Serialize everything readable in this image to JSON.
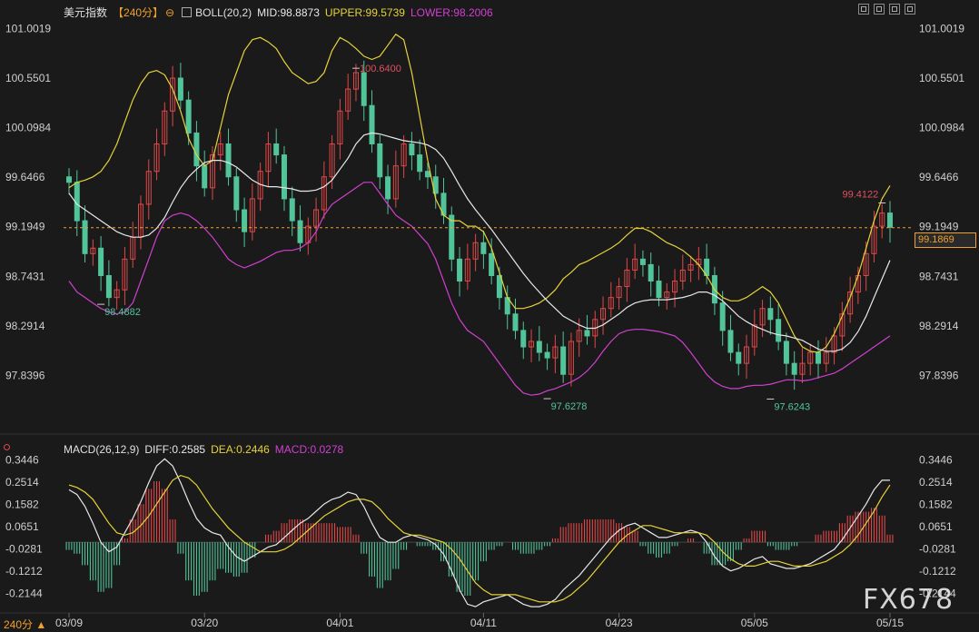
{
  "header": {
    "name": "美元指数",
    "period": "【240分】",
    "indicator": "BOLL(20,2)",
    "mid": "MID:98.8873",
    "upper": "UPPER:99.5739",
    "lower": "LOWER:98.2006"
  },
  "macd_header": {
    "label": "MACD(26,12,9)",
    "diff": "DIFF:0.2585",
    "dea": "DEA:0.2446",
    "macd": "MACD:0.0278"
  },
  "period_bottom": "240分",
  "watermark": "FX678",
  "current_price": "99.1869",
  "colors": {
    "background": "#1a1a1a",
    "up": "#e04848",
    "down": "#52c49a",
    "mid": "#e8e8e8",
    "upper": "#e6d23a",
    "lower": "#d040d0",
    "accent": "#f0a030"
  },
  "chart_data": [
    {
      "type": "candlestick",
      "name": "price",
      "y_ticks": [
        "101.0019",
        "100.5501",
        "100.0984",
        "99.6466",
        "99.1949",
        "98.7431",
        "98.2914",
        "97.8396"
      ],
      "ylim": [
        97.62,
        101.08
      ],
      "x_ticks": [
        "03/09",
        "03/20",
        "04/01",
        "04/11",
        "04/23",
        "05/05",
        "05/15"
      ],
      "annotations": [
        {
          "label": "100.6400",
          "value": 100.64
        },
        {
          "label": "98.4882",
          "value": 98.4882
        },
        {
          "label": "97.6278",
          "value": 97.6278
        },
        {
          "label": "97.6243",
          "value": 97.6243
        },
        {
          "label": "99.4122",
          "value": 99.4122
        }
      ],
      "close": [
        99.6,
        99.25,
        98.95,
        99.0,
        98.75,
        98.55,
        98.62,
        98.9,
        99.1,
        99.4,
        99.7,
        99.95,
        100.25,
        100.55,
        100.35,
        100.05,
        99.75,
        99.55,
        99.85,
        99.95,
        99.65,
        99.35,
        99.15,
        99.45,
        99.7,
        99.95,
        99.85,
        99.45,
        99.25,
        99.05,
        99.2,
        99.35,
        99.65,
        99.95,
        100.25,
        100.45,
        100.6,
        100.3,
        99.95,
        99.65,
        99.45,
        99.75,
        99.95,
        99.85,
        99.7,
        99.65,
        99.5,
        99.3,
        98.9,
        98.7,
        98.9,
        99.05,
        98.95,
        98.75,
        98.55,
        98.4,
        98.25,
        98.1,
        98.15,
        98.05,
        98.0,
        98.1,
        97.85,
        98.15,
        98.25,
        98.2,
        98.35,
        98.45,
        98.55,
        98.65,
        98.8,
        98.9,
        98.85,
        98.7,
        98.55,
        98.6,
        98.7,
        98.8,
        98.85,
        98.9,
        98.75,
        98.5,
        98.25,
        98.05,
        97.95,
        98.1,
        98.3,
        98.45,
        98.35,
        98.15,
        97.95,
        97.85,
        97.95,
        98.05,
        97.95,
        98.05,
        98.2,
        98.4,
        98.6,
        98.75,
        98.95,
        99.2,
        99.32,
        99.19
      ],
      "mid": [
        99.5,
        99.4,
        99.35,
        99.3,
        99.25,
        99.2,
        99.15,
        99.12,
        99.1,
        99.1,
        99.12,
        99.18,
        99.28,
        99.42,
        99.55,
        99.65,
        99.72,
        99.78,
        99.8,
        99.8,
        99.78,
        99.74,
        99.68,
        99.62,
        99.58,
        99.56,
        99.56,
        99.55,
        99.54,
        99.52,
        99.52,
        99.53,
        99.56,
        99.62,
        99.72,
        99.82,
        99.95,
        100.03,
        100.05,
        100.04,
        100.02,
        100.0,
        99.98,
        99.97,
        99.96,
        99.94,
        99.9,
        99.82,
        99.7,
        99.57,
        99.45,
        99.35,
        99.26,
        99.17,
        99.07,
        98.97,
        98.87,
        98.77,
        98.68,
        98.6,
        98.52,
        98.45,
        98.38,
        98.34,
        98.3,
        98.27,
        98.27,
        98.3,
        98.35,
        98.4,
        98.46,
        98.5,
        98.52,
        98.53,
        98.53,
        98.53,
        98.54,
        98.55,
        98.57,
        98.6,
        98.6,
        98.57,
        98.52,
        98.45,
        98.38,
        98.33,
        98.29,
        98.26,
        98.23,
        98.21,
        98.2,
        98.18,
        98.16,
        98.12,
        98.08,
        98.06,
        98.06,
        98.08,
        98.14,
        98.24,
        98.38,
        98.55,
        98.72,
        98.89
      ],
      "upper": [
        99.55,
        99.6,
        99.62,
        99.65,
        99.7,
        99.8,
        99.95,
        100.15,
        100.35,
        100.5,
        100.6,
        100.62,
        100.58,
        100.45,
        100.25,
        100.0,
        99.85,
        99.75,
        99.8,
        100.1,
        100.4,
        100.6,
        100.8,
        100.9,
        100.92,
        100.88,
        100.82,
        100.7,
        100.6,
        100.55,
        100.5,
        100.52,
        100.6,
        100.8,
        100.92,
        100.88,
        100.82,
        100.75,
        100.72,
        100.75,
        100.85,
        100.95,
        100.9,
        100.6,
        100.2,
        99.8,
        99.45,
        99.3,
        99.25,
        99.25,
        99.2,
        99.2,
        99.15,
        99.0,
        98.78,
        98.55,
        98.45,
        98.45,
        98.47,
        98.5,
        98.55,
        98.62,
        98.72,
        98.78,
        98.85,
        98.88,
        98.92,
        98.96,
        99.0,
        99.05,
        99.12,
        99.18,
        99.18,
        99.15,
        99.1,
        99.05,
        99.02,
        98.98,
        98.92,
        98.85,
        98.75,
        98.62,
        98.55,
        98.52,
        98.52,
        98.55,
        98.6,
        98.65,
        98.6,
        98.5,
        98.35,
        98.2,
        98.1,
        98.06,
        98.05,
        98.1,
        98.22,
        98.38,
        98.55,
        98.75,
        99.0,
        99.25,
        99.45,
        99.57
      ],
      "lower": [
        98.7,
        98.6,
        98.55,
        98.5,
        98.45,
        98.42,
        98.4,
        98.42,
        98.5,
        98.7,
        98.9,
        99.1,
        99.25,
        99.3,
        99.32,
        99.3,
        99.25,
        99.18,
        99.1,
        99.0,
        98.9,
        98.85,
        98.82,
        98.85,
        98.88,
        98.92,
        98.96,
        98.98,
        98.98,
        99.0,
        99.05,
        99.15,
        99.3,
        99.4,
        99.45,
        99.5,
        99.55,
        99.6,
        99.6,
        99.5,
        99.4,
        99.3,
        99.25,
        99.2,
        99.12,
        99.04,
        98.9,
        98.7,
        98.5,
        98.35,
        98.25,
        98.2,
        98.15,
        98.05,
        97.95,
        97.85,
        97.75,
        97.68,
        97.66,
        97.67,
        97.7,
        97.72,
        97.75,
        97.78,
        97.82,
        97.88,
        97.96,
        98.06,
        98.15,
        98.22,
        98.25,
        98.26,
        98.26,
        98.25,
        98.24,
        98.22,
        98.2,
        98.14,
        98.05,
        97.95,
        97.85,
        97.78,
        97.74,
        97.72,
        97.72,
        97.74,
        97.75,
        97.75,
        97.76,
        97.78,
        97.8,
        97.8,
        97.79,
        97.8,
        97.82,
        97.84,
        97.86,
        97.9,
        97.95,
        98.0,
        98.05,
        98.1,
        98.15,
        98.2
      ]
    },
    {
      "type": "bar",
      "name": "MACD",
      "y_ticks": [
        "0.3446",
        "0.2514",
        "0.1582",
        "0.0651",
        "-0.0281",
        "-0.1212",
        "-0.2144"
      ],
      "ylim": [
        -0.285,
        0.37
      ],
      "diff": [
        0.22,
        0.2,
        0.15,
        0.08,
        0.0,
        -0.04,
        -0.02,
        0.04,
        0.1,
        0.17,
        0.25,
        0.32,
        0.35,
        0.32,
        0.25,
        0.17,
        0.1,
        0.06,
        0.04,
        0.03,
        -0.02,
        -0.06,
        -0.08,
        -0.06,
        -0.04,
        -0.02,
        -0.01,
        0.02,
        0.05,
        0.08,
        0.1,
        0.13,
        0.16,
        0.18,
        0.19,
        0.21,
        0.2,
        0.15,
        0.08,
        0.02,
        0.0,
        0.0,
        0.02,
        0.03,
        0.02,
        0.01,
        -0.01,
        -0.05,
        -0.12,
        -0.2,
        -0.26,
        -0.27,
        -0.25,
        -0.24,
        -0.23,
        -0.22,
        -0.24,
        -0.26,
        -0.27,
        -0.27,
        -0.26,
        -0.24,
        -0.2,
        -0.17,
        -0.14,
        -0.1,
        -0.06,
        -0.02,
        0.02,
        0.05,
        0.07,
        0.08,
        0.06,
        0.04,
        0.02,
        0.02,
        0.03,
        0.04,
        0.05,
        0.04,
        0.0,
        -0.06,
        -0.1,
        -0.12,
        -0.11,
        -0.09,
        -0.07,
        -0.06,
        -0.09,
        -0.1,
        -0.11,
        -0.11,
        -0.1,
        -0.09,
        -0.07,
        -0.05,
        -0.03,
        0.01,
        0.06,
        0.11,
        0.16,
        0.22,
        0.26,
        0.26
      ],
      "dea": [
        0.24,
        0.23,
        0.21,
        0.18,
        0.13,
        0.08,
        0.04,
        0.03,
        0.04,
        0.07,
        0.11,
        0.16,
        0.21,
        0.26,
        0.28,
        0.27,
        0.24,
        0.19,
        0.14,
        0.1,
        0.06,
        0.03,
        0.0,
        -0.02,
        -0.04,
        -0.04,
        -0.04,
        -0.03,
        -0.01,
        0.02,
        0.05,
        0.08,
        0.11,
        0.13,
        0.15,
        0.17,
        0.18,
        0.18,
        0.17,
        0.14,
        0.1,
        0.07,
        0.04,
        0.03,
        0.03,
        0.02,
        0.01,
        0.0,
        -0.03,
        -0.07,
        -0.12,
        -0.17,
        -0.2,
        -0.22,
        -0.22,
        -0.22,
        -0.22,
        -0.23,
        -0.24,
        -0.25,
        -0.25,
        -0.25,
        -0.24,
        -0.22,
        -0.19,
        -0.16,
        -0.12,
        -0.08,
        -0.04,
        0.0,
        0.03,
        0.05,
        0.07,
        0.07,
        0.06,
        0.05,
        0.04,
        0.04,
        0.04,
        0.04,
        0.03,
        0.0,
        -0.04,
        -0.07,
        -0.09,
        -0.1,
        -0.1,
        -0.09,
        -0.08,
        -0.08,
        -0.09,
        -0.1,
        -0.1,
        -0.1,
        -0.09,
        -0.08,
        -0.06,
        -0.04,
        -0.01,
        0.03,
        0.08,
        0.13,
        0.19,
        0.24
      ],
      "macd": [
        -0.02,
        -0.03,
        -0.06,
        -0.1,
        -0.13,
        -0.12,
        -0.06,
        0.01,
        0.06,
        0.1,
        0.14,
        0.16,
        0.14,
        0.06,
        -0.03,
        -0.1,
        -0.14,
        -0.13,
        -0.1,
        -0.07,
        -0.08,
        -0.09,
        -0.08,
        -0.04,
        0.0,
        0.02,
        0.03,
        0.05,
        0.06,
        0.06,
        0.05,
        0.05,
        0.05,
        0.05,
        0.04,
        0.04,
        0.02,
        -0.03,
        -0.09,
        -0.12,
        -0.1,
        -0.07,
        -0.02,
        0.0,
        -0.01,
        -0.01,
        -0.02,
        -0.05,
        -0.09,
        -0.13,
        -0.14,
        -0.1,
        -0.05,
        -0.02,
        -0.01,
        0.0,
        -0.02,
        -0.03,
        -0.03,
        -0.02,
        -0.01,
        0.01,
        0.04,
        0.05,
        0.05,
        0.06,
        0.06,
        0.06,
        0.06,
        0.05,
        0.04,
        0.03,
        -0.01,
        -0.03,
        -0.04,
        -0.03,
        -0.01,
        0.0,
        0.01,
        0.0,
        -0.03,
        -0.06,
        -0.06,
        -0.05,
        -0.02,
        0.01,
        0.03,
        0.03,
        -0.01,
        -0.02,
        -0.02,
        -0.01,
        0.0,
        0.0,
        0.02,
        0.03,
        0.03,
        0.05,
        0.07,
        0.08,
        0.08,
        0.09,
        0.07,
        0.02
      ]
    }
  ]
}
